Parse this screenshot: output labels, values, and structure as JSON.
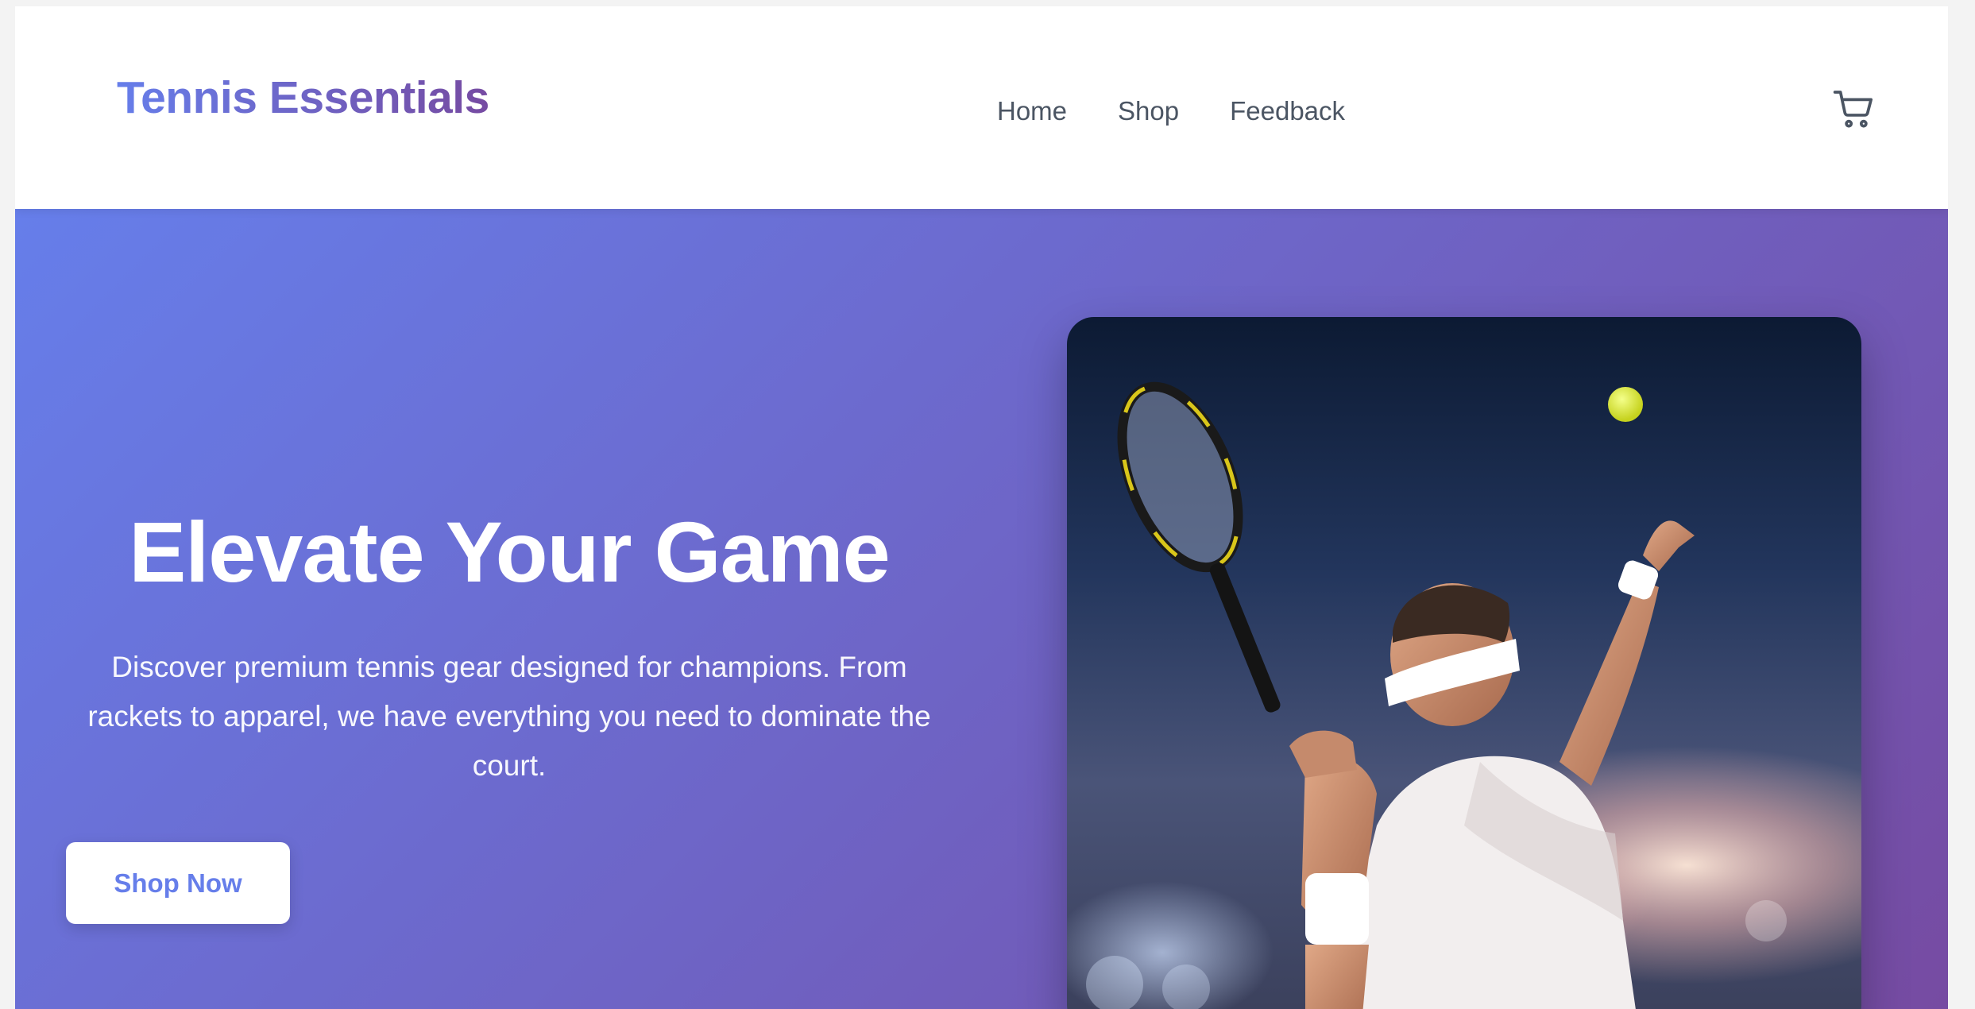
{
  "brand": {
    "name": "Tennis Essentials"
  },
  "nav": {
    "links": [
      {
        "label": "Home"
      },
      {
        "label": "Shop"
      },
      {
        "label": "Feedback"
      }
    ],
    "cart_icon": "shopping-cart-icon"
  },
  "hero": {
    "title": "Elevate Your Game",
    "description": "Discover premium tennis gear designed for champions. From rackets to apparel, we have everything you need to dominate the court.",
    "cta_label": "Shop Now",
    "image_subject": "tennis-player-serving-photo"
  },
  "colors": {
    "brand_gradient_start": "#667eea",
    "brand_gradient_end": "#764ba2",
    "nav_text": "#4b5563",
    "button_bg": "#ffffff",
    "button_text": "#667eea"
  }
}
